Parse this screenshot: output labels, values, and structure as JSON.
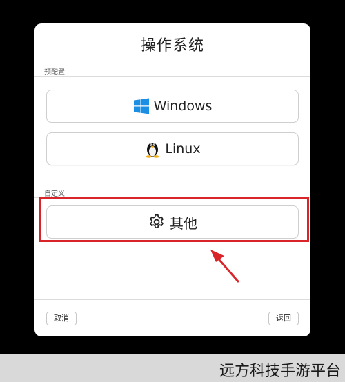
{
  "dialog": {
    "title": "操作系统",
    "preset_label": "预配置",
    "custom_label": "自定义",
    "options": [
      {
        "label": "Windows",
        "icon": "windows-logo-icon"
      },
      {
        "label": "Linux",
        "icon": "linux-tux-icon"
      },
      {
        "label": "其他",
        "icon": "gear-icon"
      }
    ],
    "cancel_label": "取消",
    "back_label": "返回"
  },
  "annotation": {
    "highlight_color": "#d9252a"
  },
  "watermark": {
    "text": "远方科技手游平台"
  },
  "colors": {
    "windows_blue": "#1a8fe3",
    "accent_red": "#d9252a"
  }
}
